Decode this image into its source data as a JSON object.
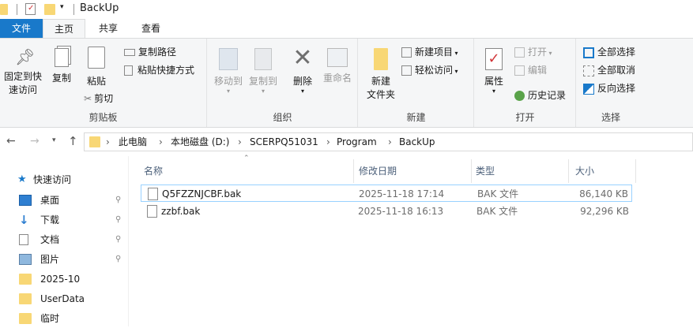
{
  "window": {
    "title": "BackUp"
  },
  "tabs": [
    {
      "label": "文件",
      "active": true
    },
    {
      "label": "主页"
    },
    {
      "label": "共享"
    },
    {
      "label": "查看"
    }
  ],
  "ribbon": {
    "clipboard": {
      "label": "剪贴板",
      "pin": "固定到快",
      "pin2": "速访问",
      "copy": "复制",
      "paste": "粘贴",
      "copy_path": "复制路径",
      "paste_shortcut": "粘贴快捷方式",
      "cut": "剪切"
    },
    "organize": {
      "label": "组织",
      "move_to": "移动到",
      "copy_to": "复制到",
      "delete": "删除",
      "rename": "重命名"
    },
    "new": {
      "label": "新建",
      "new_folder": "新建",
      "new_folder2": "文件夹",
      "new_item": "新建项目",
      "easy_access": "轻松访问"
    },
    "open": {
      "label": "打开",
      "properties": "属性",
      "open": "打开",
      "edit": "编辑",
      "history": "历史记录"
    },
    "select": {
      "label": "选择",
      "select_all": "全部选择",
      "select_none": "全部取消",
      "invert": "反向选择"
    }
  },
  "address": {
    "crumbs": [
      "此电脑",
      "本地磁盘 (D:)",
      "SCERPQ51031",
      "Program",
      "BackUp"
    ]
  },
  "nav": {
    "quick_access": "快速访问",
    "items": [
      {
        "label": "桌面",
        "icon": "desktop-icon"
      },
      {
        "label": "下载",
        "icon": "download-icon"
      },
      {
        "label": "文档",
        "icon": "document-icon"
      },
      {
        "label": "图片",
        "icon": "picture-icon"
      },
      {
        "label": "2025-10",
        "icon": "folder-icon"
      },
      {
        "label": "UserData",
        "icon": "folder-icon"
      },
      {
        "label": "临时",
        "icon": "folder-icon"
      }
    ]
  },
  "list": {
    "columns": [
      "名称",
      "修改日期",
      "类型",
      "大小"
    ],
    "rows": [
      {
        "name": "Q5FZZNJCBF.bak",
        "date": "2025-11-18 17:14",
        "type": "BAK 文件",
        "size": "86,140 KB"
      },
      {
        "name": "zzbf.bak",
        "date": "2025-11-18 16:13",
        "type": "BAK 文件",
        "size": "92,296 KB"
      }
    ]
  },
  "colors": {
    "accent": "#1979ca",
    "folder": "#f8d775",
    "selected_border": "#99d1ff"
  }
}
